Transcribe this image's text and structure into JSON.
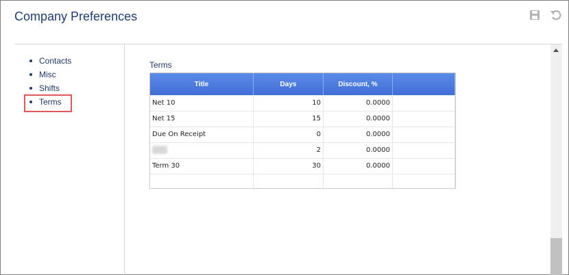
{
  "header": {
    "title": "Company Preferences",
    "icons": {
      "save": "save-icon",
      "undo": "undo-icon"
    }
  },
  "sidebar": {
    "items": [
      {
        "label": "Contacts"
      },
      {
        "label": "Misc"
      },
      {
        "label": "Shifts"
      },
      {
        "label": "Terms"
      }
    ],
    "selected": "Terms",
    "highlight_color": "#e0565a"
  },
  "main": {
    "section_label": "Terms",
    "table": {
      "columns": [
        "Title",
        "Days",
        "Discount, %",
        ""
      ],
      "rows": [
        {
          "title": "Net 10",
          "days": "10",
          "discount": "0.0000"
        },
        {
          "title": "Net 15",
          "days": "15",
          "discount": "0.0000"
        },
        {
          "title": "Due On Receipt",
          "days": "0",
          "discount": "0.0000"
        },
        {
          "title": "",
          "days": "2",
          "discount": "0.0000"
        },
        {
          "title": "Term 30",
          "days": "30",
          "discount": "0.0000"
        },
        {
          "title": "",
          "days": "",
          "discount": ""
        }
      ]
    }
  },
  "colors": {
    "header_bg": "#4a7de0",
    "text": "#1f3864"
  }
}
